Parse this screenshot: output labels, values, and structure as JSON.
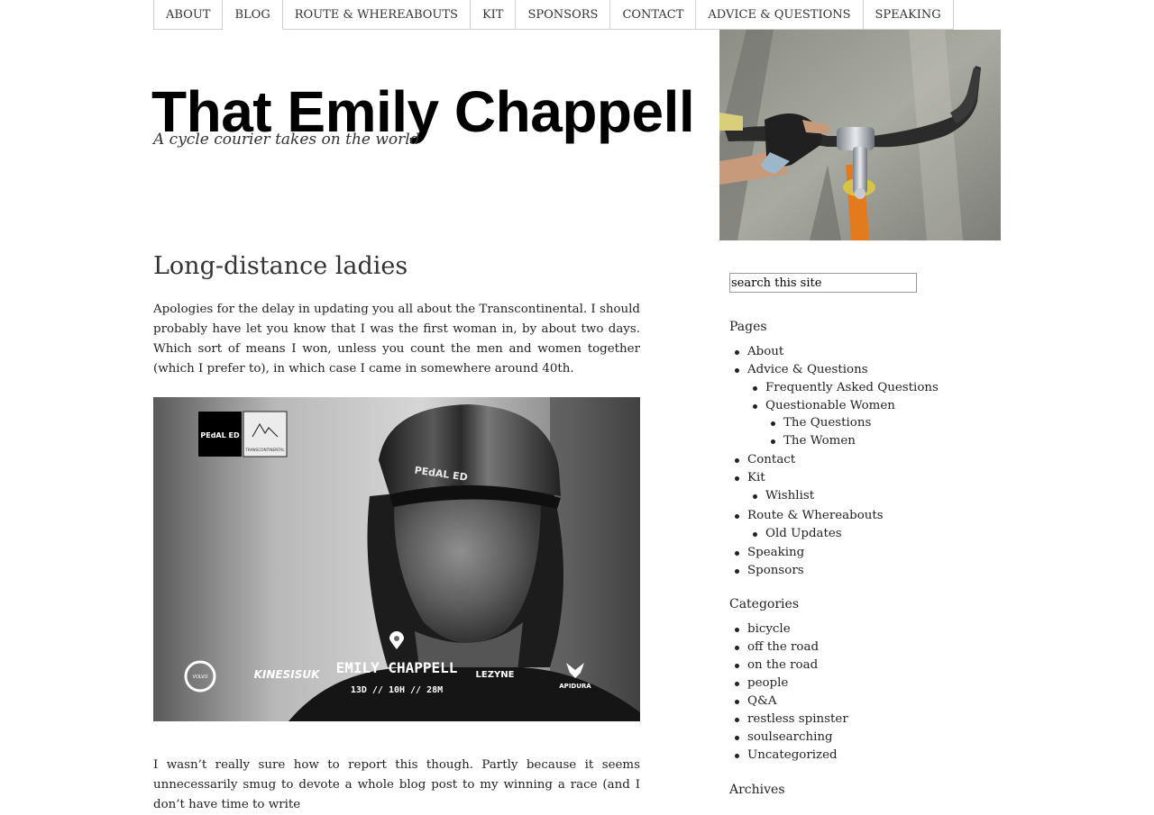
{
  "nav": {
    "tabs": [
      {
        "label": "ABOUT"
      },
      {
        "label": "BLOG"
      },
      {
        "label": "ROUTE & WHEREABOUTS"
      },
      {
        "label": "KIT"
      },
      {
        "label": "SPONSORS"
      },
      {
        "label": "CONTACT"
      },
      {
        "label": "ADVICE & QUESTIONS"
      },
      {
        "label": "SPEAKING"
      }
    ],
    "current": "BLOG"
  },
  "site": {
    "title": "That Emily Chappell",
    "tagline": "A cycle courier takes on the world"
  },
  "post": {
    "title": "Long-distance ladies",
    "para1": "Apologies for the delay in updating you all about the Transcontinental. I should probably have let you know that I was the first woman in, by about two days. Which sort of means I won, unless you count the men and women together (which I prefer to), in which case I came in somewhere around 40th.",
    "para2": "I wasn’t really sure how to report this though. Partly because it seems unnecessarily smug to devote a whole blog post to my winning a race (and I don’t have time to write",
    "image": {
      "logo_left": "PEdAL ED",
      "logo_right": "TRANSCONTINENTAL",
      "cap_text": "PEdAL ED",
      "rider_name": "EMILY CHAPPELL",
      "finish_time": "13D // 10H // 28M",
      "sponsor_volvo": "VOLVO",
      "sponsor_kinesis": "KINESISUK",
      "sponsor_lezyne": "LEZYNE",
      "sponsor_apidura": "APIDURA"
    }
  },
  "sidebar": {
    "search_value": "search this site",
    "pages_title": "Pages",
    "pages": [
      {
        "label": "About",
        "level": 0
      },
      {
        "label": "Advice & Questions",
        "level": 0
      },
      {
        "label": "Frequently Asked Questions",
        "level": 1
      },
      {
        "label": "Questionable Women",
        "level": 1
      },
      {
        "label": "The Questions",
        "level": 2
      },
      {
        "label": "The Women",
        "level": 2
      },
      {
        "label": "Contact",
        "level": 0
      },
      {
        "label": "Kit",
        "level": 0
      },
      {
        "label": "Wishlist",
        "level": 1
      },
      {
        "label": "Route & Whereabouts",
        "level": 0
      },
      {
        "label": "Old Updates",
        "level": 1
      },
      {
        "label": "Speaking",
        "level": 0
      },
      {
        "label": "Sponsors",
        "level": 0
      }
    ],
    "categories_title": "Categories",
    "categories": [
      "bicycle",
      "off the road",
      "on the road",
      "people",
      "Q&A",
      "restless spinster",
      "soulsearching",
      "Uncategorized"
    ],
    "archives_title": "Archives"
  }
}
